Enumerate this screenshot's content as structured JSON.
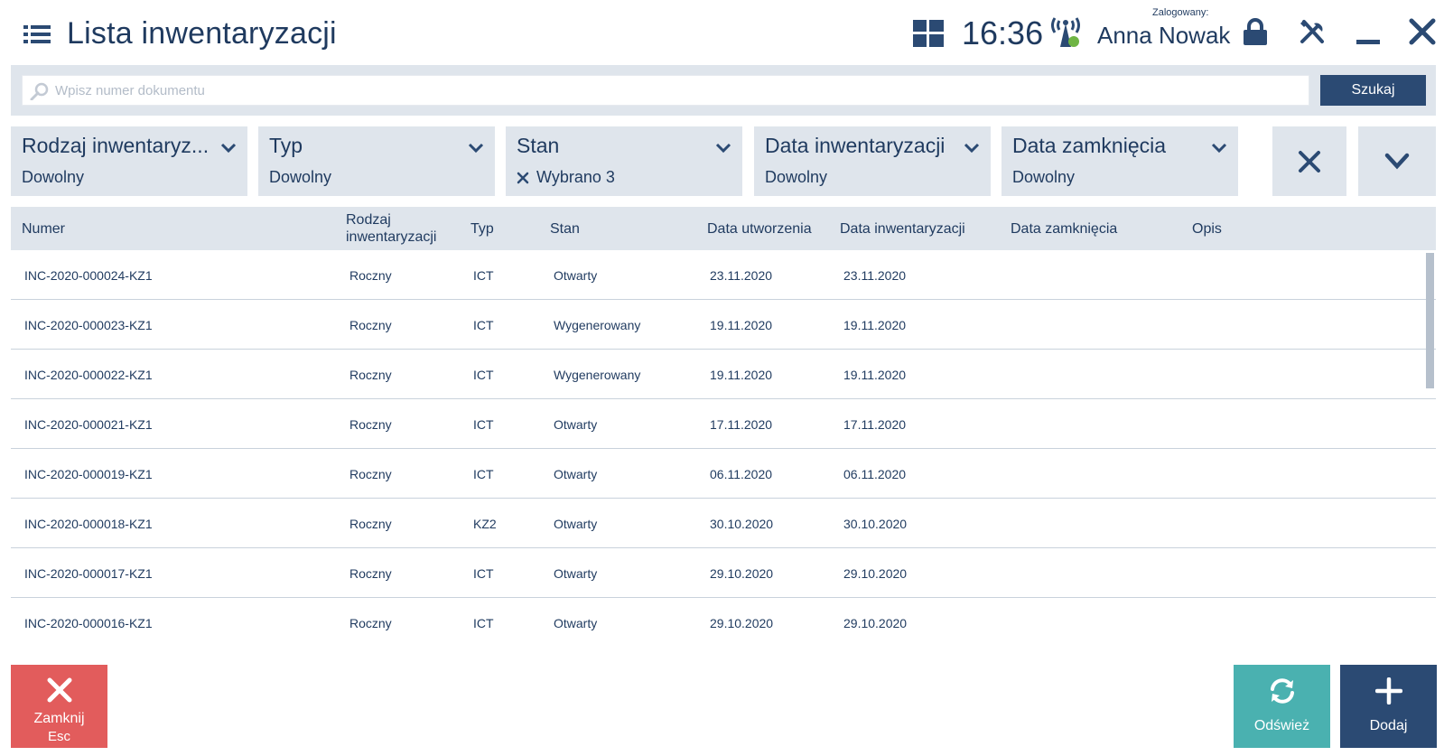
{
  "header": {
    "title": "Lista inwentaryzacji",
    "time": "16:36",
    "logged_label": "Zalogowany:",
    "user": "Anna Nowak"
  },
  "search": {
    "placeholder": "Wpisz numer dokumentu",
    "value": "",
    "button": "Szukaj"
  },
  "filters": [
    {
      "label": "Rodzaj inwentaryz...",
      "value": "Dowolny"
    },
    {
      "label": "Typ",
      "value": "Dowolny"
    },
    {
      "label": "Stan",
      "value": "Wybrano 3"
    },
    {
      "label": "Data inwentaryzacji",
      "value": "Dowolny"
    },
    {
      "label": "Data zamknięcia",
      "value": "Dowolny"
    }
  ],
  "table": {
    "columns": {
      "numer": "Numer",
      "rodzaj_1": "Rodzaj",
      "rodzaj_2": "inwentaryzacji",
      "typ": "Typ",
      "stan": "Stan",
      "data_utworzenia": "Data utworzenia",
      "data_inwentaryzacji": "Data inwentaryzacji",
      "data_zamkniecia": "Data zamknięcia",
      "opis": "Opis"
    },
    "rows": [
      {
        "numer": "INC-2020-000024-KZ1",
        "rodzaj": "Roczny",
        "typ": "ICT",
        "stan": "Otwarty",
        "data_utworzenia": "23.11.2020",
        "data_inwentaryzacji": "23.11.2020",
        "data_zamkniecia": "",
        "opis": ""
      },
      {
        "numer": "INC-2020-000023-KZ1",
        "rodzaj": "Roczny",
        "typ": "ICT",
        "stan": "Wygenerowany",
        "data_utworzenia": "19.11.2020",
        "data_inwentaryzacji": "19.11.2020",
        "data_zamkniecia": "",
        "opis": ""
      },
      {
        "numer": "INC-2020-000022-KZ1",
        "rodzaj": "Roczny",
        "typ": "ICT",
        "stan": "Wygenerowany",
        "data_utworzenia": "19.11.2020",
        "data_inwentaryzacji": "19.11.2020",
        "data_zamkniecia": "",
        "opis": ""
      },
      {
        "numer": "INC-2020-000021-KZ1",
        "rodzaj": "Roczny",
        "typ": "ICT",
        "stan": "Otwarty",
        "data_utworzenia": "17.11.2020",
        "data_inwentaryzacji": "17.11.2020",
        "data_zamkniecia": "",
        "opis": ""
      },
      {
        "numer": "INC-2020-000019-KZ1",
        "rodzaj": "Roczny",
        "typ": "ICT",
        "stan": "Otwarty",
        "data_utworzenia": "06.11.2020",
        "data_inwentaryzacji": "06.11.2020",
        "data_zamkniecia": "",
        "opis": ""
      },
      {
        "numer": "INC-2020-000018-KZ1",
        "rodzaj": "Roczny",
        "typ": "KZ2",
        "stan": "Otwarty",
        "data_utworzenia": "30.10.2020",
        "data_inwentaryzacji": "30.10.2020",
        "data_zamkniecia": "",
        "opis": ""
      },
      {
        "numer": "INC-2020-000017-KZ1",
        "rodzaj": "Roczny",
        "typ": "ICT",
        "stan": "Otwarty",
        "data_utworzenia": "29.10.2020",
        "data_inwentaryzacji": "29.10.2020",
        "data_zamkniecia": "",
        "opis": ""
      },
      {
        "numer": "INC-2020-000016-KZ1",
        "rodzaj": "Roczny",
        "typ": "ICT",
        "stan": "Otwarty",
        "data_utworzenia": "29.10.2020",
        "data_inwentaryzacji": "29.10.2020",
        "data_zamkniecia": "",
        "opis": ""
      }
    ]
  },
  "footer": {
    "close_label": "Zamknij",
    "close_shortcut": "Esc",
    "refresh_label": "Odśwież",
    "add_label": "Dodaj"
  },
  "icons": {
    "menu": "hamburger-list-icon",
    "tiles": "grid-icon",
    "signal": "antenna-signal-icon",
    "lock": "lock-icon",
    "tools": "tools-icon",
    "minimize": "minimize-icon",
    "close": "close-icon",
    "search": "search-icon",
    "chevron": "chevron-down-icon",
    "refresh": "refresh-icon",
    "add": "plus-icon"
  },
  "colors": {
    "primary": "#2b4a73",
    "text": "#1f3a5f",
    "panel": "#dfe5ec",
    "danger": "#e25c5c",
    "teal": "#4ab1b0",
    "signal_dot": "#6fb544"
  }
}
